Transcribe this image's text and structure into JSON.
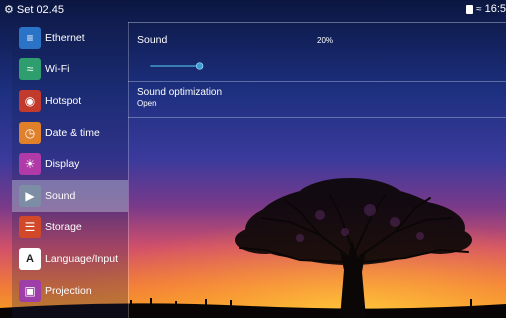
{
  "status": {
    "time": "Set 02.45",
    "clock_right": "16:5"
  },
  "sidebar": {
    "items": [
      {
        "label": "Ethernet",
        "icon": "ethernet-icon",
        "color": "#2a73c7",
        "active": false
      },
      {
        "label": "Wi-Fi",
        "icon": "wifi-icon",
        "color": "#2f9e6e",
        "active": false
      },
      {
        "label": "Hotspot",
        "icon": "hotspot-icon",
        "color": "#c23a2c",
        "active": false
      },
      {
        "label": "Date & time",
        "icon": "clock-icon",
        "color": "#e0802a",
        "active": false
      },
      {
        "label": "Display",
        "icon": "brightness-icon",
        "color": "#b03aa8",
        "active": false
      },
      {
        "label": "Sound",
        "icon": "speaker-icon",
        "color": "#7d8da5",
        "active": true
      },
      {
        "label": "Storage",
        "icon": "storage-icon",
        "color": "#d2492a",
        "active": false
      },
      {
        "label": "Language/Input",
        "icon": "keyboard-a-icon",
        "color": "#ffffff",
        "active": false
      },
      {
        "label": "Projection",
        "icon": "projection-icon",
        "color": "#9e3ea8",
        "active": false
      }
    ]
  },
  "panel": {
    "sound_label": "Sound",
    "sound_value": "20%",
    "sound_level": 0.2,
    "optimization_label": "Sound optimization",
    "optimization_value": "Open"
  },
  "colors": {
    "slider_track": "#4aa8d8",
    "slider_thumb": "#3a9fd6"
  }
}
